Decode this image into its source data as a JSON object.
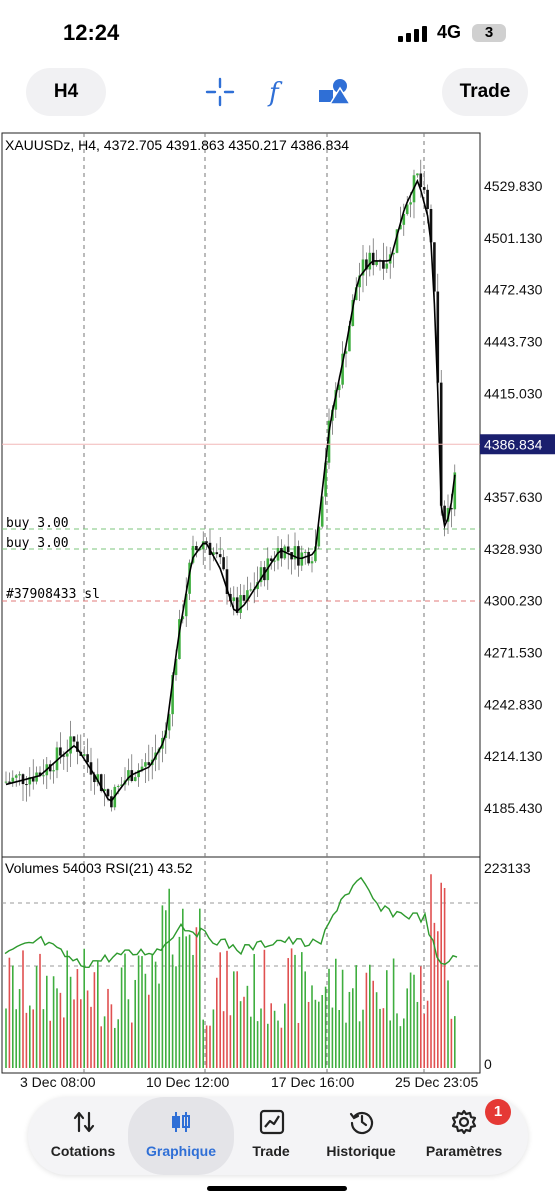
{
  "status_bar": {
    "time": "12:24",
    "network": "4G",
    "battery": "3"
  },
  "toolbar": {
    "timeframe": "H4",
    "trade_label": "Trade",
    "icons": [
      "crosshair-icon",
      "function-icon",
      "shapes-icon"
    ]
  },
  "chart": {
    "header": "XAUUSDz, H4, 4372.705 4391.863 4350.217 4386.834",
    "volume_header": "Volumes 54003 RSI(21) 43.52",
    "current_price": "4386.834",
    "price_ticks": [
      "4529.830",
      "4501.130",
      "4472.430",
      "4443.730",
      "4415.030",
      "4357.630",
      "4328.930",
      "4300.230",
      "4271.530",
      "4242.830",
      "4214.130",
      "4185.430"
    ],
    "volume_ticks": [
      "223133",
      "0"
    ],
    "date_labels": [
      "3 Dec 08:00",
      "10 Dec 12:00",
      "17 Dec 16:00",
      "25 Dec 23:05"
    ],
    "order_labels": [
      "buy 3.00",
      "buy 3.00",
      "#37908433 sl"
    ],
    "colors": {
      "bull": "#3fae3f",
      "bear": "#111111",
      "ma": "#000000",
      "rsi": "#2e9a2e",
      "vol_up": "#3fae3f",
      "vol_down": "#e05050",
      "price_tag_bg": "#1a1f6e",
      "price_line": "#f2b8b8"
    }
  },
  "tabs": [
    {
      "label": "Cotations",
      "icon": "updown-arrows-icon"
    },
    {
      "label": "Graphique",
      "icon": "candlestick-icon"
    },
    {
      "label": "Trade",
      "icon": "trend-chart-icon"
    },
    {
      "label": "Historique",
      "icon": "history-clock-icon"
    },
    {
      "label": "Paramètres",
      "icon": "gear-icon",
      "badge": "1"
    }
  ]
}
